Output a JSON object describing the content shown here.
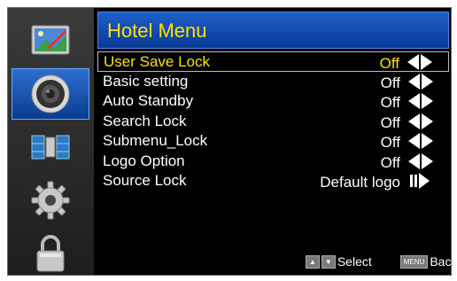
{
  "header": {
    "title": "Hotel Menu"
  },
  "sidebar": {
    "items": [
      {
        "icon": "picture-icon"
      },
      {
        "icon": "speaker-icon",
        "active": true
      },
      {
        "icon": "satellite-icon"
      },
      {
        "icon": "gear-icon"
      },
      {
        "icon": "lock-icon"
      }
    ]
  },
  "menu": {
    "rows": [
      {
        "label": "User Save Lock",
        "value": "Off",
        "control": "left-right-arrows",
        "selected": true
      },
      {
        "label": "Basic setting",
        "value": "Off",
        "control": "left-right-arrows"
      },
      {
        "label": "Auto Standby",
        "value": "Off",
        "control": "left-right-arrows"
      },
      {
        "label": "Search Lock",
        "value": "Off",
        "control": "left-right-arrows"
      },
      {
        "label": "Submenu_Lock",
        "value": "Off",
        "control": "left-right-arrows"
      },
      {
        "label": "Logo Option",
        "value": "Off",
        "control": "left-right-arrows"
      },
      {
        "label": "Source Lock",
        "value": "Default logo",
        "control": "enter-arrow"
      }
    ]
  },
  "footer": {
    "select_label": "Select",
    "menu_key": "MENU",
    "back_label": "Back"
  },
  "colors": {
    "accent_text": "#ffe000",
    "header_blue": "#1d5fc8",
    "background": "#000000"
  }
}
